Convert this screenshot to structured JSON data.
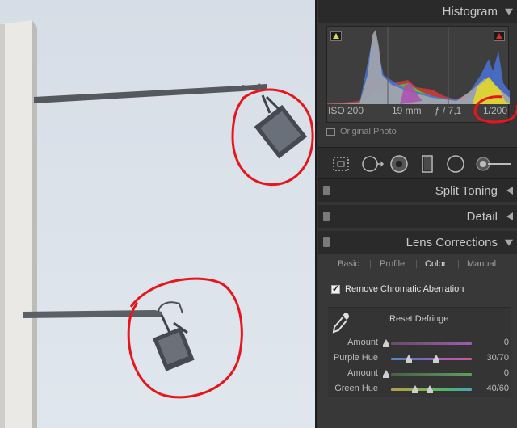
{
  "panel": {
    "histogram": {
      "title": "Histogram",
      "iso": "ISO 200",
      "focal_length": "19 mm",
      "aperture": "ƒ / 7,1",
      "shutter": "1/200",
      "original_photo_label": "Original Photo"
    },
    "sections": {
      "split_toning": "Split Toning",
      "detail": "Detail",
      "lens_corrections": "Lens Corrections"
    },
    "lens": {
      "tabs": [
        "Basic",
        "Profile",
        "Color",
        "Manual"
      ],
      "active_tab": "Color",
      "remove_ca_label": "Remove Chromatic Aberration",
      "remove_ca_checked": true,
      "reset_defringe": "Reset Defringe",
      "sliders": [
        {
          "label": "Amount",
          "value": "0"
        },
        {
          "label": "Purple Hue",
          "value": "30/70"
        },
        {
          "label": "Amount",
          "value": "0"
        },
        {
          "label": "Green Hue",
          "value": "40/60"
        }
      ]
    }
  },
  "colors": {
    "annotation": "#e8161a",
    "panel_bg": "#353535",
    "header_bg": "#2a2a2a",
    "sky": "#dbe2ea"
  },
  "icons": [
    "clipping-shadow-icon",
    "clipping-highlight-icon",
    "crop-overlay-icon",
    "spot-removal-icon",
    "red-eye-icon",
    "graduated-filter-icon",
    "radial-filter-icon",
    "adjustment-brush-icon",
    "eyedropper-icon",
    "checkbox-icon"
  ]
}
